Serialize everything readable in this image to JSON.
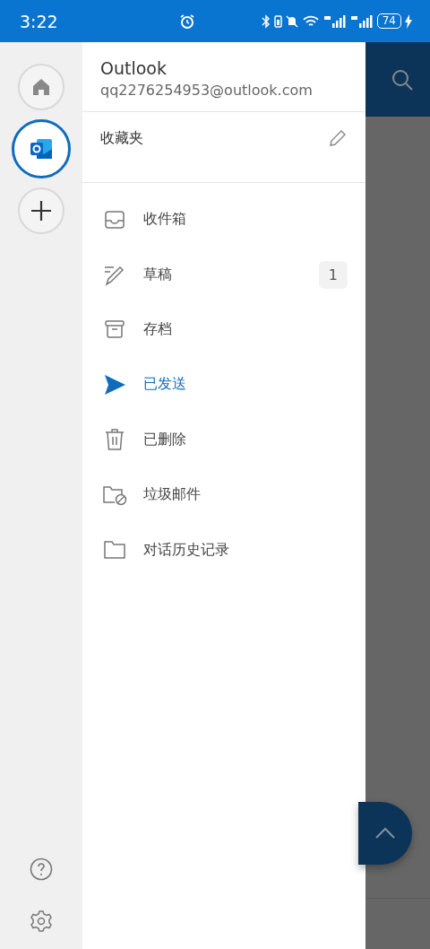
{
  "status_bar": {
    "time": "3:22",
    "battery": "74"
  },
  "account": {
    "name": "Outlook",
    "email": "qq2276254953@outlook.com"
  },
  "rail": [
    {
      "kind": "home",
      "selected": false
    },
    {
      "kind": "outlook",
      "selected": true
    },
    {
      "kind": "add",
      "selected": false
    }
  ],
  "favorites": {
    "label": "收藏夹"
  },
  "folders": [
    {
      "kind": "inbox",
      "label": "收件箱",
      "selected": false
    },
    {
      "kind": "drafts",
      "label": "草稿",
      "selected": false,
      "count": "1"
    },
    {
      "kind": "archive",
      "label": "存档",
      "selected": false
    },
    {
      "kind": "sent",
      "label": "已发送",
      "selected": true
    },
    {
      "kind": "deleted",
      "label": "已删除",
      "selected": false
    },
    {
      "kind": "junk",
      "label": "垃圾邮件",
      "selected": false
    },
    {
      "kind": "folder",
      "label": "对话历史记录",
      "selected": false
    }
  ]
}
